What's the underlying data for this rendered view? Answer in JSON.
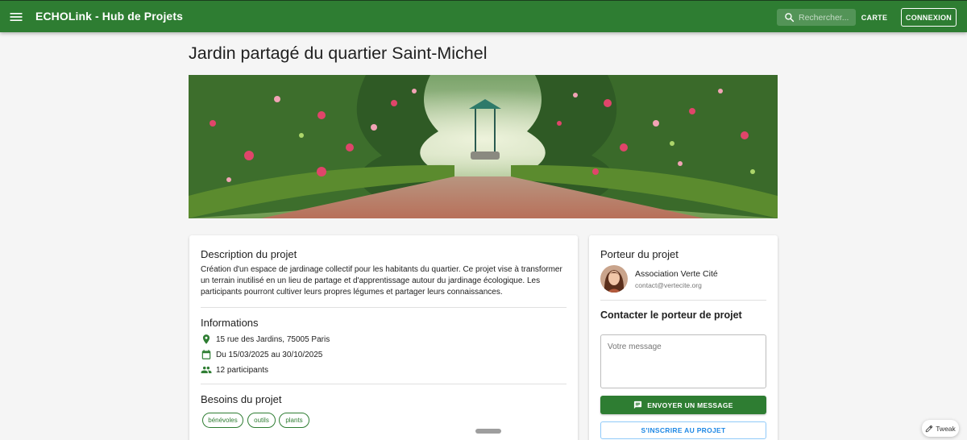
{
  "header": {
    "app_title": "ECHOLink - Hub de Projets",
    "search_placeholder": "Rechercher...",
    "map_button": "CARTE",
    "login_button": "CONNEXION"
  },
  "project": {
    "title": "Jardin partagé du quartier Saint-Michel",
    "description_title": "Description du projet",
    "description": "Création d'un espace de jardinage collectif pour les habitants du quartier. Ce projet vise à transformer un terrain inutilisé en un lieu de partage et d'apprentissage autour du jardinage écologique. Les participants pourront cultiver leurs propres légumes et partager leurs connaissances.",
    "info_title": "Informations",
    "address": "15 rue des Jardins, 75005 Paris",
    "dates": "Du 15/03/2025 au 30/10/2025",
    "participants": "12 participants",
    "needs_title": "Besoins du projet",
    "needs": [
      "bénévoles",
      "outils",
      "plants"
    ]
  },
  "owner": {
    "section_title": "Porteur du projet",
    "name": "Association Verte Cité",
    "email": "contact@vertecite.org"
  },
  "contact": {
    "section_title": "Contacter le porteur de projet",
    "message_placeholder": "Votre message",
    "send_button": "ENVOYER UN MESSAGE",
    "join_button": "S'INSCRIRE AU PROJET"
  },
  "tweak_label": "Tweak",
  "colors": {
    "primary": "#2e7d32",
    "background": "#f5f5f5",
    "accent_blue": "#1e88e5"
  },
  "icons": {
    "menu": "menu-icon",
    "search": "search-icon",
    "location": "location-pin-icon",
    "calendar": "calendar-icon",
    "people": "people-icon",
    "message": "message-icon",
    "pencil": "pencil-icon"
  }
}
